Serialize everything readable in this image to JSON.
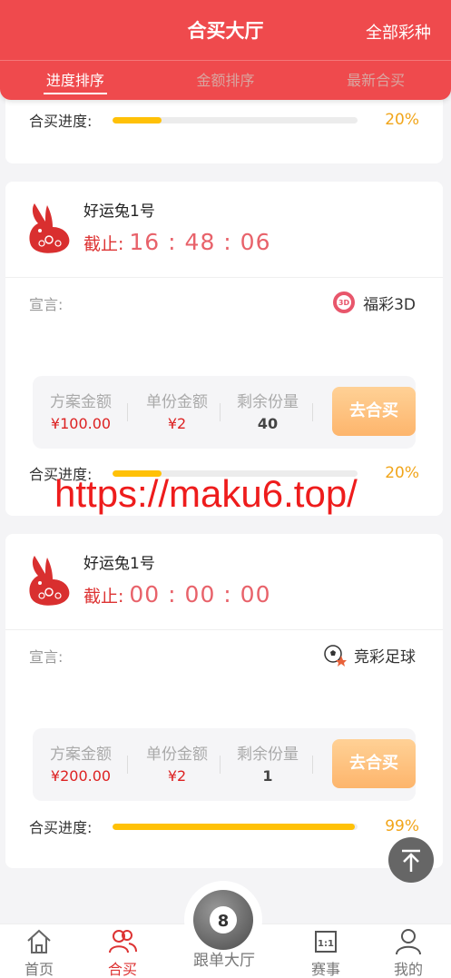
{
  "header": {
    "title": "合买大厅",
    "right_link": "全部彩种",
    "tabs": [
      "进度排序",
      "金额排序",
      "最新合买"
    ]
  },
  "cards": [
    {
      "progress_label": "合买进度:",
      "progress_pct": "20%",
      "progress_fraction": 0.2
    },
    {
      "name": "好运兔1号",
      "deadline_label": "截止:",
      "deadline_time": "16 : 48 : 06",
      "declare_label": "宣言:",
      "lottery": "福彩3D",
      "lottery_icon": "fucai-3d-icon",
      "stats": {
        "total_label": "方案金额",
        "total_value": "¥100.00",
        "unit_label": "单份金额",
        "unit_value": "¥2",
        "remain_label": "剩余份量",
        "remain_value": "40"
      },
      "buy_label": "去合买",
      "progress_label": "合买进度:",
      "progress_pct": "20%",
      "progress_fraction": 0.2
    },
    {
      "name": "好运兔1号",
      "deadline_label": "截止:",
      "deadline_time": "00 : 00 : 00",
      "declare_label": "宣言:",
      "lottery": "竞彩足球",
      "lottery_icon": "football-icon",
      "stats": {
        "total_label": "方案金额",
        "total_value": "¥200.00",
        "unit_label": "单份金额",
        "unit_value": "¥2",
        "remain_label": "剩余份量",
        "remain_value": "1"
      },
      "buy_label": "去合买",
      "progress_label": "合买进度:",
      "progress_pct": "99%",
      "progress_fraction": 0.99
    }
  ],
  "watermark": "https://maku6.top/",
  "bottom_nav": {
    "home": "首页",
    "group_buy": "合买",
    "follow": "跟单大厅",
    "matches": "赛事",
    "mine": "我的"
  },
  "colors": {
    "primary": "#ef4a4d",
    "progress": "#ffc107",
    "button": "#fdb56c"
  }
}
